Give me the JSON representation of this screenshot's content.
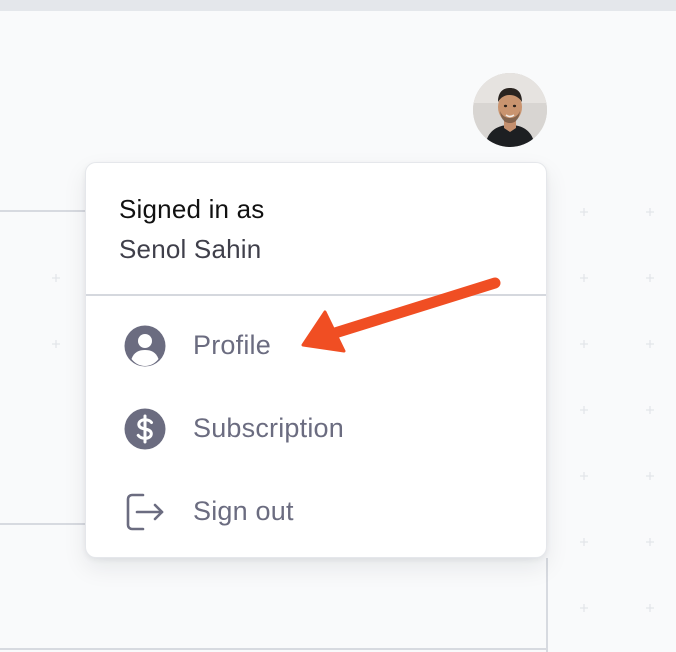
{
  "user_menu": {
    "signed_in_label": "Signed in as",
    "user_name": "Senol Sahin",
    "items": [
      {
        "label": "Profile",
        "icon": "user-circle-icon"
      },
      {
        "label": "Subscription",
        "icon": "dollar-circle-icon"
      },
      {
        "label": "Sign out",
        "icon": "sign-out-icon"
      }
    ]
  },
  "colors": {
    "accent_arrow": "#f04e23",
    "menu_text": "#6b6c80",
    "icon_fill": "#6b6c80",
    "background": "#f9fafb"
  }
}
